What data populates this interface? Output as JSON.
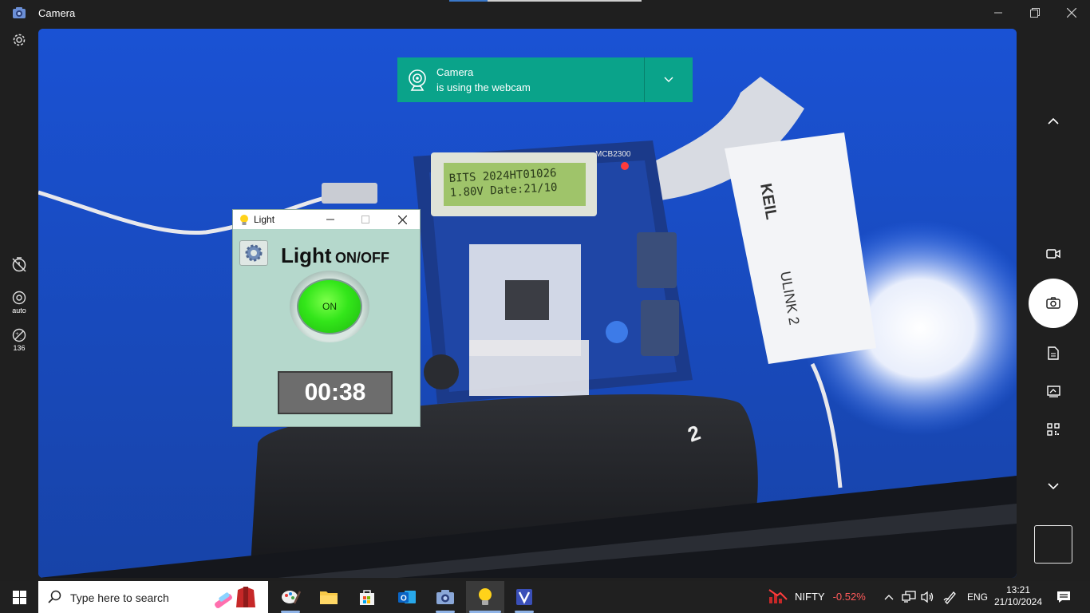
{
  "window": {
    "title": "Camera",
    "icon": "camera-app-icon"
  },
  "left_rail": {
    "settings_icon": "gear-icon",
    "timer_icon": "timer-off-icon",
    "focus": {
      "icon": "auto-focus-icon",
      "label": "auto"
    },
    "exposure": {
      "icon": "exposure-icon",
      "label": "136"
    }
  },
  "right_rail": {
    "items": [
      "chevron-up-icon",
      "video-icon",
      "photo-shutter-icon",
      "document-icon",
      "whiteboard-icon",
      "qr-code-icon",
      "chevron-down-icon"
    ],
    "gallery": "last-capture-thumbnail"
  },
  "notification": {
    "title": "Camera",
    "subtitle": "is using the webcam",
    "icon": "webcam-icon",
    "expand_icon": "chevron-down-icon"
  },
  "light_window": {
    "title": "Light",
    "heading_big": "Light",
    "heading_small": "ON/OFF",
    "button_label": "ON",
    "timer": "00:38",
    "button_color": "#33e61a"
  },
  "scene": {
    "lcd_line1": "BITS 2024HT01026",
    "lcd_line2": "1.80V Date:21/10",
    "board_label": "MCB2300",
    "probe_brand": "KEIL",
    "probe_model": "ULINK 2"
  },
  "taskbar": {
    "search_placeholder": "Type here to search",
    "apps": [
      "paint-icon",
      "file-explorer-icon",
      "store-icon",
      "outlook-icon",
      "camera-icon",
      "light-app-icon",
      "keil-uvision-icon"
    ],
    "ticker_name": "NIFTY",
    "ticker_change": "-0.52%",
    "language": "ENG",
    "time": "13:21",
    "date": "21/10/2024"
  },
  "colors": {
    "notification": "#0aa38a",
    "taskbar": "#202020",
    "light_window_bg": "#b5d8cc",
    "ticker_negative": "#ff5a5a"
  }
}
